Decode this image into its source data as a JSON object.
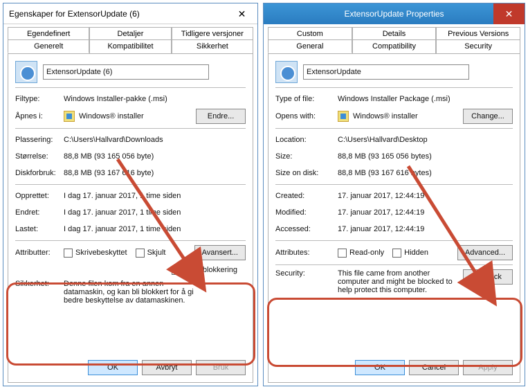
{
  "left": {
    "title": "Egenskaper for ExtensorUpdate (6)",
    "tabs1": [
      "Egendefinert",
      "Detaljer",
      "Tidligere versjoner"
    ],
    "tabs2": [
      "Generelt",
      "Kompatibilitet",
      "Sikkerhet"
    ],
    "name": "ExtensorUpdate (6)",
    "lbl_filetype": "Filtype:",
    "val_filetype": "Windows Installer-pakke (.msi)",
    "lbl_opens": "Åpnes i:",
    "val_opens": "Windows® installer",
    "btn_change": "Endre...",
    "lbl_location": "Plassering:",
    "val_location": "C:\\Users\\Hallvard\\Downloads",
    "lbl_size": "Størrelse:",
    "val_size": "88,8 MB (93 165 056 byte)",
    "lbl_disk": "Diskforbruk:",
    "val_disk": "88,8 MB (93 167 616 byte)",
    "lbl_created": "Opprettet:",
    "val_created": "I dag 17. januar 2017, 1 time siden",
    "lbl_modified": "Endret:",
    "val_modified": "I dag 17. januar 2017, 1 time siden",
    "lbl_accessed": "Lastet:",
    "val_accessed": "I dag 17. januar 2017, 1 time siden",
    "lbl_attributes": "Attributter:",
    "chk_readonly": "Skrivebeskyttet",
    "chk_hidden": "Skjult",
    "btn_advanced": "Avansert...",
    "chk_unblock": "Fjern blokkering",
    "lbl_security": "Sikkerhet:",
    "val_security": "Denne filen kom fra en annen datamaskin, og kan bli blokkert for å gi bedre beskyttelse av datamaskinen.",
    "btn_ok": "OK",
    "btn_cancel": "Avbryt",
    "btn_apply": "Bruk"
  },
  "right": {
    "title": "ExtensorUpdate Properties",
    "tabs1": [
      "Custom",
      "Details",
      "Previous Versions"
    ],
    "tabs2": [
      "General",
      "Compatibility",
      "Security"
    ],
    "name": "ExtensorUpdate",
    "lbl_filetype": "Type of file:",
    "val_filetype": "Windows Installer Package (.msi)",
    "lbl_opens": "Opens with:",
    "val_opens": "Windows® installer",
    "btn_change": "Change...",
    "lbl_location": "Location:",
    "val_location": "C:\\Users\\Hallvard\\Desktop",
    "lbl_size": "Size:",
    "val_size": "88,8 MB (93 165 056 bytes)",
    "lbl_disk": "Size on disk:",
    "val_disk": "88,8 MB (93 167 616 bytes)",
    "lbl_created": "Created:",
    "val_created": "17. januar 2017, 12:44:19",
    "lbl_modified": "Modified:",
    "val_modified": "17. januar 2017, 12:44:19",
    "lbl_accessed": "Accessed:",
    "val_accessed": "17. januar 2017, 12:44:19",
    "lbl_attributes": "Attributes:",
    "chk_readonly": "Read-only",
    "chk_hidden": "Hidden",
    "btn_advanced": "Advanced...",
    "lbl_security": "Security:",
    "val_security": "This file came from another computer and might be blocked to help protect this computer.",
    "btn_unblock": "Unblock",
    "btn_ok": "OK",
    "btn_cancel": "Cancel",
    "btn_apply": "Apply"
  }
}
